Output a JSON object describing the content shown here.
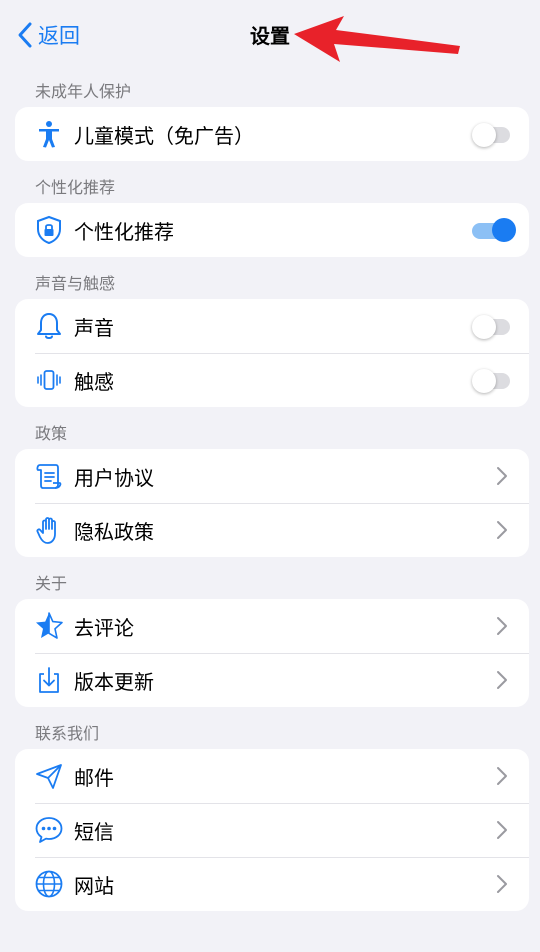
{
  "nav": {
    "back_label": "返回",
    "title": "设置"
  },
  "accent": "#1a7cf2",
  "sections": {
    "minor": {
      "label": "未成年人保护",
      "kids_mode": {
        "label": "儿童模式（免广告）",
        "icon": "person-icon",
        "toggle_on": false
      }
    },
    "personal": {
      "label": "个性化推荐",
      "recommend": {
        "label": "个性化推荐",
        "icon": "shield-lock-icon",
        "toggle_on": true
      }
    },
    "sound": {
      "label": "声音与触感",
      "sound": {
        "label": "声音",
        "icon": "bell-icon",
        "toggle_on": false
      },
      "haptic": {
        "label": "触感",
        "icon": "phone-vibrate-icon",
        "toggle_on": false
      }
    },
    "policy": {
      "label": "政策",
      "agreement": {
        "label": "用户协议",
        "icon": "scroll-icon"
      },
      "privacy": {
        "label": "隐私政策",
        "icon": "hand-icon"
      }
    },
    "about": {
      "label": "关于",
      "rate": {
        "label": "去评论",
        "icon": "star-icon"
      },
      "update": {
        "label": "版本更新",
        "icon": "download-icon"
      }
    },
    "contact": {
      "label": "联系我们",
      "email": {
        "label": "邮件",
        "icon": "send-icon"
      },
      "sms": {
        "label": "短信",
        "icon": "message-icon"
      },
      "website": {
        "label": "网站",
        "icon": "globe-icon"
      }
    }
  }
}
